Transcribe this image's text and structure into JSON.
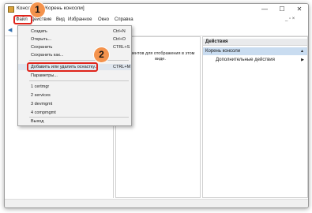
{
  "window": {
    "title_visible_part": "Консоль1 - [Корень консоли]",
    "controls": {
      "minimize": "—",
      "maximize": "☐",
      "close": "✕"
    }
  },
  "menubar": {
    "items": [
      "Файл",
      "Действие",
      "Вид",
      "Избранное",
      "Окно",
      "Справка"
    ],
    "mdi_controls": "_ ▫ ×"
  },
  "file_menu": {
    "items": [
      {
        "label": "Создать",
        "shortcut": "Ctrl+N"
      },
      {
        "label": "Открыть...",
        "shortcut": "Ctrl+O"
      },
      {
        "label": "Сохранить",
        "shortcut": "CTRL+S"
      },
      {
        "label": "Сохранить как...",
        "shortcut": ""
      },
      {
        "label": "Добавить или удалить оснастку...",
        "shortcut": "CTRL+M"
      },
      {
        "label": "Параметры...",
        "shortcut": ""
      },
      {
        "label": "1 certmgr",
        "shortcut": ""
      },
      {
        "label": "2 services",
        "shortcut": ""
      },
      {
        "label": "3 devmgmt",
        "shortcut": ""
      },
      {
        "label": "4 compmgmt",
        "shortcut": ""
      },
      {
        "label": "Выход",
        "shortcut": ""
      }
    ]
  },
  "center": {
    "message": "...ментов для отображения в этом виде."
  },
  "actions": {
    "header": "Действия",
    "section": "Корень консоли",
    "item": "Дополнительные действия"
  },
  "annotations": {
    "step1": "1",
    "step2": "2",
    "highlight_color": "#e0241b",
    "badge_color": "#f4934d"
  }
}
